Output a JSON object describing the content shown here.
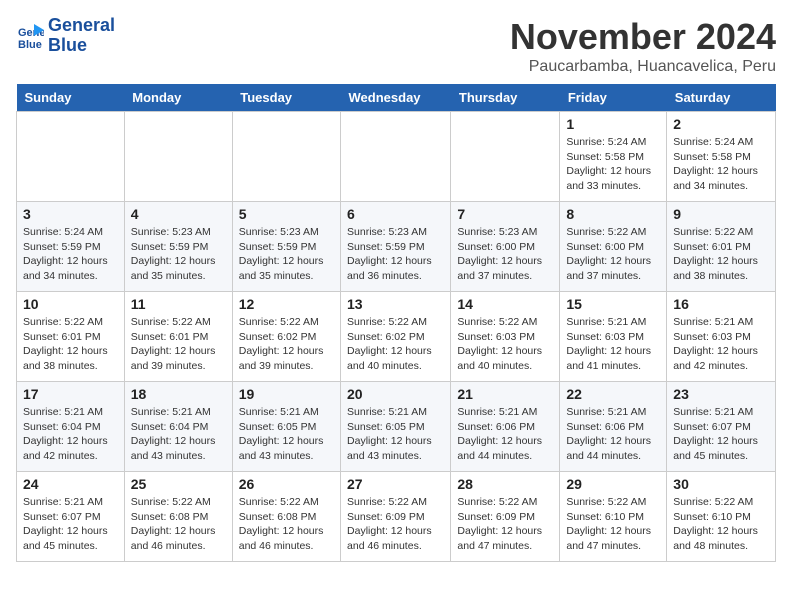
{
  "logo": {
    "line1": "General",
    "line2": "Blue"
  },
  "title": "November 2024",
  "location": "Paucarbamba, Huancavelica, Peru",
  "weekdays": [
    "Sunday",
    "Monday",
    "Tuesday",
    "Wednesday",
    "Thursday",
    "Friday",
    "Saturday"
  ],
  "weeks": [
    [
      {
        "day": "",
        "info": ""
      },
      {
        "day": "",
        "info": ""
      },
      {
        "day": "",
        "info": ""
      },
      {
        "day": "",
        "info": ""
      },
      {
        "day": "",
        "info": ""
      },
      {
        "day": "1",
        "info": "Sunrise: 5:24 AM\nSunset: 5:58 PM\nDaylight: 12 hours\nand 33 minutes."
      },
      {
        "day": "2",
        "info": "Sunrise: 5:24 AM\nSunset: 5:58 PM\nDaylight: 12 hours\nand 34 minutes."
      }
    ],
    [
      {
        "day": "3",
        "info": "Sunrise: 5:24 AM\nSunset: 5:59 PM\nDaylight: 12 hours\nand 34 minutes."
      },
      {
        "day": "4",
        "info": "Sunrise: 5:23 AM\nSunset: 5:59 PM\nDaylight: 12 hours\nand 35 minutes."
      },
      {
        "day": "5",
        "info": "Sunrise: 5:23 AM\nSunset: 5:59 PM\nDaylight: 12 hours\nand 35 minutes."
      },
      {
        "day": "6",
        "info": "Sunrise: 5:23 AM\nSunset: 5:59 PM\nDaylight: 12 hours\nand 36 minutes."
      },
      {
        "day": "7",
        "info": "Sunrise: 5:23 AM\nSunset: 6:00 PM\nDaylight: 12 hours\nand 37 minutes."
      },
      {
        "day": "8",
        "info": "Sunrise: 5:22 AM\nSunset: 6:00 PM\nDaylight: 12 hours\nand 37 minutes."
      },
      {
        "day": "9",
        "info": "Sunrise: 5:22 AM\nSunset: 6:01 PM\nDaylight: 12 hours\nand 38 minutes."
      }
    ],
    [
      {
        "day": "10",
        "info": "Sunrise: 5:22 AM\nSunset: 6:01 PM\nDaylight: 12 hours\nand 38 minutes."
      },
      {
        "day": "11",
        "info": "Sunrise: 5:22 AM\nSunset: 6:01 PM\nDaylight: 12 hours\nand 39 minutes."
      },
      {
        "day": "12",
        "info": "Sunrise: 5:22 AM\nSunset: 6:02 PM\nDaylight: 12 hours\nand 39 minutes."
      },
      {
        "day": "13",
        "info": "Sunrise: 5:22 AM\nSunset: 6:02 PM\nDaylight: 12 hours\nand 40 minutes."
      },
      {
        "day": "14",
        "info": "Sunrise: 5:22 AM\nSunset: 6:03 PM\nDaylight: 12 hours\nand 40 minutes."
      },
      {
        "day": "15",
        "info": "Sunrise: 5:21 AM\nSunset: 6:03 PM\nDaylight: 12 hours\nand 41 minutes."
      },
      {
        "day": "16",
        "info": "Sunrise: 5:21 AM\nSunset: 6:03 PM\nDaylight: 12 hours\nand 42 minutes."
      }
    ],
    [
      {
        "day": "17",
        "info": "Sunrise: 5:21 AM\nSunset: 6:04 PM\nDaylight: 12 hours\nand 42 minutes."
      },
      {
        "day": "18",
        "info": "Sunrise: 5:21 AM\nSunset: 6:04 PM\nDaylight: 12 hours\nand 43 minutes."
      },
      {
        "day": "19",
        "info": "Sunrise: 5:21 AM\nSunset: 6:05 PM\nDaylight: 12 hours\nand 43 minutes."
      },
      {
        "day": "20",
        "info": "Sunrise: 5:21 AM\nSunset: 6:05 PM\nDaylight: 12 hours\nand 43 minutes."
      },
      {
        "day": "21",
        "info": "Sunrise: 5:21 AM\nSunset: 6:06 PM\nDaylight: 12 hours\nand 44 minutes."
      },
      {
        "day": "22",
        "info": "Sunrise: 5:21 AM\nSunset: 6:06 PM\nDaylight: 12 hours\nand 44 minutes."
      },
      {
        "day": "23",
        "info": "Sunrise: 5:21 AM\nSunset: 6:07 PM\nDaylight: 12 hours\nand 45 minutes."
      }
    ],
    [
      {
        "day": "24",
        "info": "Sunrise: 5:21 AM\nSunset: 6:07 PM\nDaylight: 12 hours\nand 45 minutes."
      },
      {
        "day": "25",
        "info": "Sunrise: 5:22 AM\nSunset: 6:08 PM\nDaylight: 12 hours\nand 46 minutes."
      },
      {
        "day": "26",
        "info": "Sunrise: 5:22 AM\nSunset: 6:08 PM\nDaylight: 12 hours\nand 46 minutes."
      },
      {
        "day": "27",
        "info": "Sunrise: 5:22 AM\nSunset: 6:09 PM\nDaylight: 12 hours\nand 46 minutes."
      },
      {
        "day": "28",
        "info": "Sunrise: 5:22 AM\nSunset: 6:09 PM\nDaylight: 12 hours\nand 47 minutes."
      },
      {
        "day": "29",
        "info": "Sunrise: 5:22 AM\nSunset: 6:10 PM\nDaylight: 12 hours\nand 47 minutes."
      },
      {
        "day": "30",
        "info": "Sunrise: 5:22 AM\nSunset: 6:10 PM\nDaylight: 12 hours\nand 48 minutes."
      }
    ]
  ]
}
